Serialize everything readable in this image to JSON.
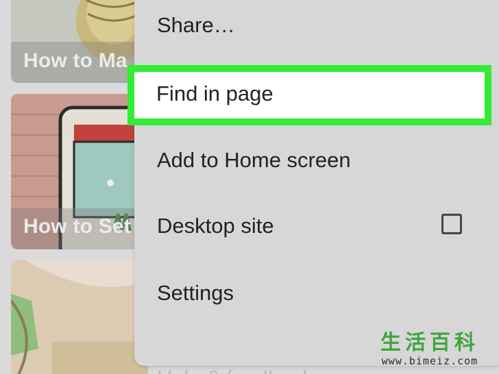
{
  "background_cards": [
    {
      "title": "How to Ma"
    },
    {
      "title": "How to Set"
    },
    {
      "title": ""
    }
  ],
  "menu": {
    "items": [
      {
        "label": "Share…"
      },
      {
        "label": "Find in page",
        "highlighted": true
      },
      {
        "label": "Add to Home screen"
      },
      {
        "label": "Desktop site",
        "checkbox": false
      },
      {
        "label": "Settings"
      },
      {
        "label": "Help & feedback"
      }
    ]
  },
  "highlight_color": "#33ec33",
  "watermark": {
    "glyphs": "生活百科",
    "url": "www.bimeiz.com"
  }
}
